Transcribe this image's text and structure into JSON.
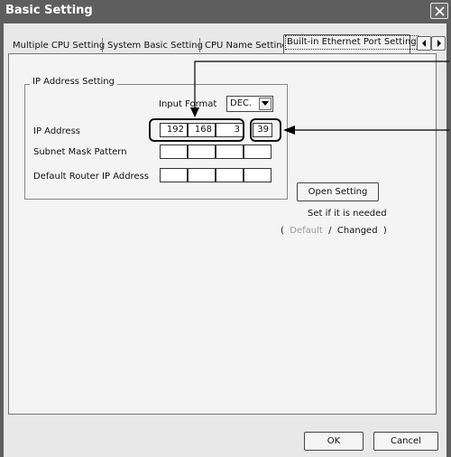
{
  "window": {
    "title": "Basic Setting"
  },
  "tabs": [
    {
      "label": "Multiple CPU Setting"
    },
    {
      "label": "System Basic Setting"
    },
    {
      "label": "CPU Name Setting"
    },
    {
      "label": "Built-in Ethernet Port Setting",
      "active": true
    }
  ],
  "ip_group": {
    "legend": "IP Address Setting",
    "input_format_label": "Input Format",
    "input_format_value": "DEC.",
    "ip_address_label": "IP Address",
    "ip_address": [
      "192",
      "168",
      "3",
      "39"
    ],
    "subnet_label": "Subnet Mask Pattern",
    "subnet_mask": [
      "",
      "",
      "",
      ""
    ],
    "router_label": "Default Router IP Address",
    "router_ip": [
      "",
      "",
      "",
      ""
    ]
  },
  "open_setting": {
    "button_label": "Open Setting",
    "note": "Set if it is needed",
    "legend_open": "(",
    "legend_default": "Default",
    "legend_slash": "/",
    "legend_changed": "Changed",
    "legend_close": ")"
  },
  "footer": {
    "ok_label": "OK",
    "cancel_label": "Cancel"
  },
  "colors": {
    "titlebar": "#5e5e5e",
    "dialog_bg": "#e8e8e8",
    "panel_bg": "#f4f4f4"
  }
}
